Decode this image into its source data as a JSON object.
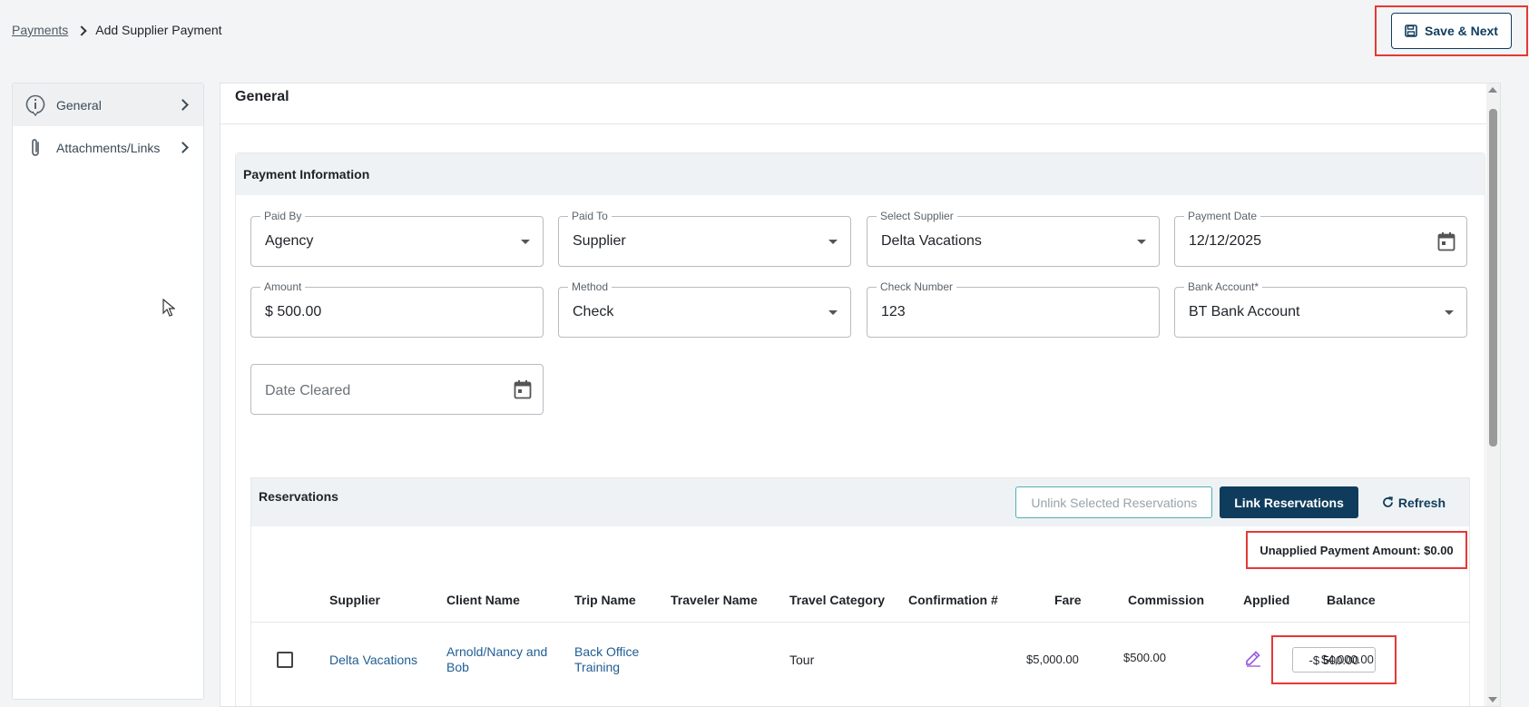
{
  "breadcrumb": {
    "parent": "Payments",
    "current": "Add Supplier Payment"
  },
  "toolbar": {
    "save_label": "Save & Next"
  },
  "sidebar": {
    "items": [
      {
        "label": "General",
        "icon": "info-icon",
        "active": true
      },
      {
        "label": "Attachments/Links",
        "icon": "paperclip-icon",
        "active": false
      }
    ]
  },
  "main": {
    "title": "General"
  },
  "payment": {
    "section_title": "Payment Information",
    "paid_by": {
      "label": "Paid By",
      "value": "Agency"
    },
    "paid_to": {
      "label": "Paid To",
      "value": "Supplier"
    },
    "supplier": {
      "label": "Select Supplier",
      "value": "Delta Vacations"
    },
    "payment_date": {
      "label": "Payment Date",
      "value": "12/12/2025"
    },
    "amount": {
      "label": "Amount",
      "value": "$ 500.00"
    },
    "method": {
      "label": "Method",
      "value": "Check"
    },
    "check_number": {
      "label": "Check Number",
      "value": "123"
    },
    "bank_account": {
      "label": "Bank Account*",
      "value": "BT Bank Account"
    },
    "date_cleared": {
      "placeholder": "Date Cleared"
    }
  },
  "reservations": {
    "title": "Reservations",
    "unlink_label": "Unlink Selected Reservations",
    "link_label": "Link Reservations",
    "refresh_label": "Refresh",
    "unapplied_text": "Unapplied Payment Amount: $0.00",
    "columns": [
      "Supplier",
      "Client Name",
      "Trip Name",
      "Traveler Name",
      "Travel Category",
      "Confirmation #",
      "Fare",
      "Commission",
      "Applied",
      "Balance"
    ],
    "rows": [
      {
        "supplier": "Delta Vacations",
        "client_name": "Arnold/Nancy and Bob",
        "trip_name": "Back Office Training",
        "traveler_name": "",
        "travel_category": "Tour",
        "confirmation": "",
        "fare": "$5,000.00",
        "commission": "$500.00",
        "applied": "-$ 500.00",
        "balance": "$4,000.00"
      }
    ]
  },
  "colors": {
    "primary": "#0f3c5c",
    "highlight": "#e53935",
    "link": "#1f5d93"
  }
}
